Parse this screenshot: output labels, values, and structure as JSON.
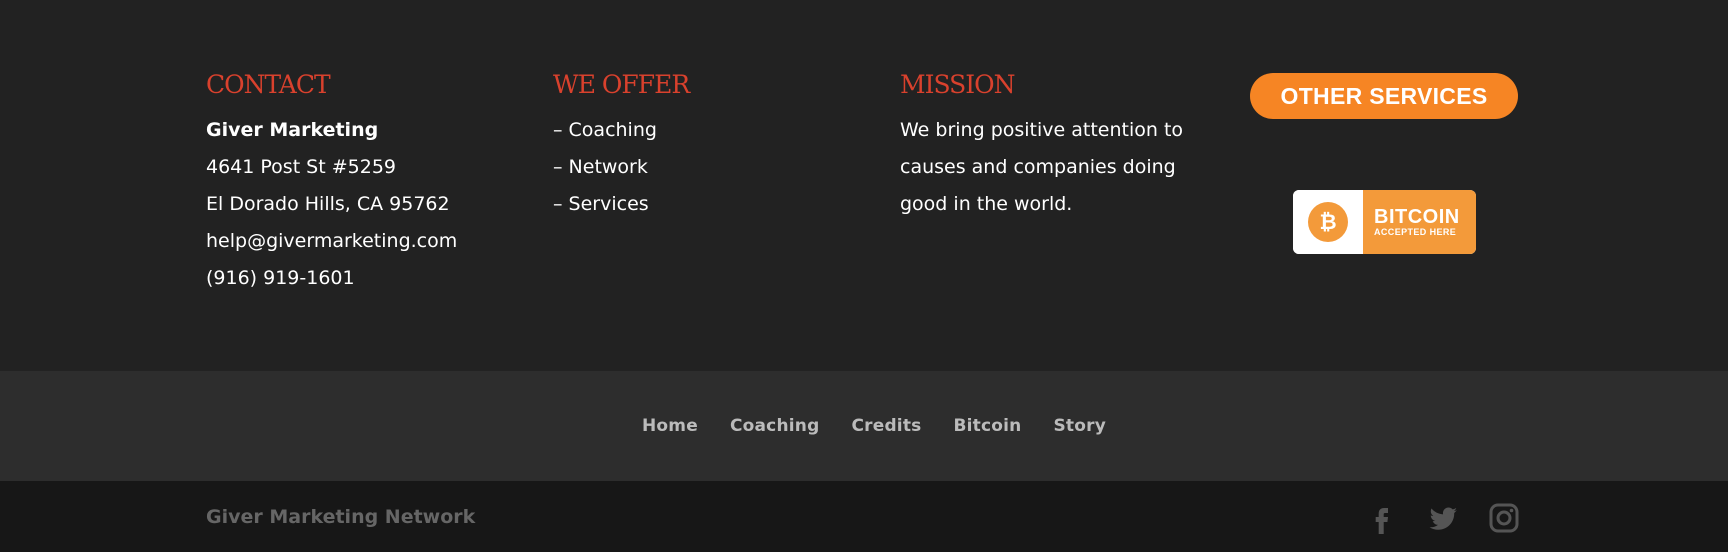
{
  "contact": {
    "heading": "CONTACT",
    "company": "Giver Marketing",
    "address1": "4641 Post St #5259",
    "address2": "El Dorado Hills, CA 95762",
    "email": "help@givermarketing.com",
    "phone": "(916) 919-1601"
  },
  "offer": {
    "heading": "WE OFFER",
    "items": [
      "– Coaching",
      "– Network",
      "– Services"
    ]
  },
  "mission": {
    "heading": "MISSION",
    "text": "We bring positive attention to causes and companies doing good in the world."
  },
  "other_services": {
    "label": "OTHER SERVICES"
  },
  "bitcoin_badge": {
    "title": "BITCOIN",
    "subtitle": "ACCEPTED HERE"
  },
  "nav": {
    "items": [
      "Home",
      "Coaching",
      "Credits",
      "Bitcoin",
      "Story"
    ]
  },
  "bottom": {
    "credit": "Giver Marketing Network",
    "social_icons": [
      "facebook-icon",
      "twitter-icon",
      "instagram-icon"
    ]
  },
  "colors": {
    "heading_red": "#d9412d",
    "accent_orange": "#f68524",
    "bitcoin_orange": "#f39a3a",
    "widget_bg": "#222222",
    "nav_bg": "#2d2d2d",
    "bottom_bg": "#171717"
  }
}
